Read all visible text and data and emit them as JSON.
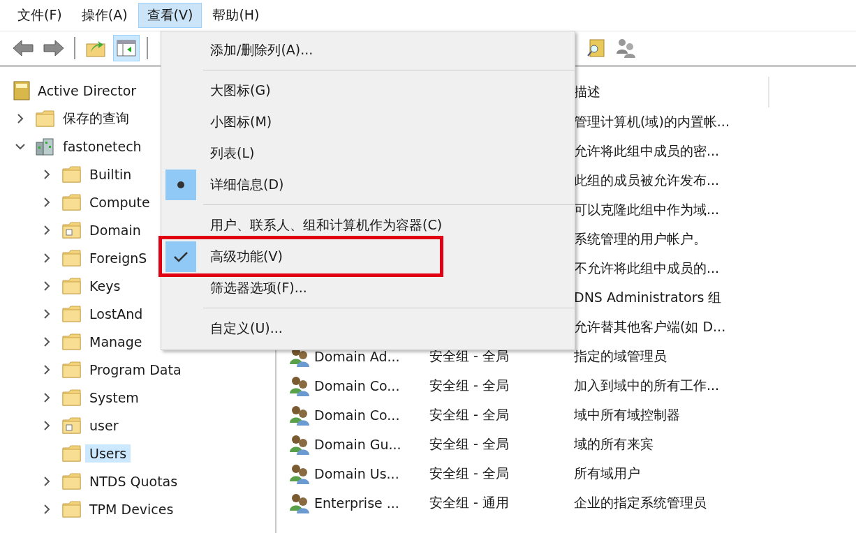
{
  "menubar": [
    {
      "label": "文件(F)",
      "selected": false
    },
    {
      "label": "操作(A)",
      "selected": false
    },
    {
      "label": "查看(V)",
      "selected": true
    },
    {
      "label": "帮助(H)",
      "selected": false
    }
  ],
  "toolbar": [
    {
      "kind": "back",
      "pressed": false
    },
    {
      "kind": "forward",
      "pressed": false
    },
    {
      "kind": "separator"
    },
    {
      "kind": "up",
      "pressed": false
    },
    {
      "kind": "console",
      "pressed": true
    },
    {
      "kind": "separator"
    },
    {
      "kind": "gap"
    },
    {
      "kind": "find",
      "pressed": false
    },
    {
      "kind": "users",
      "pressed": false
    }
  ],
  "tree": [
    {
      "label": "Active Director",
      "kind": "root",
      "selected": false,
      "children": [
        {
          "label": "保存的查询",
          "kind": "folder",
          "expanded": false,
          "selected": false
        },
        {
          "label": "fastonetech",
          "kind": "domain",
          "expanded": true,
          "selected": false,
          "children": [
            {
              "label": "Builtin",
              "kind": "folder",
              "expanded": false,
              "selected": false
            },
            {
              "label": "Compute",
              "kind": "folder",
              "expanded": false,
              "selected": false
            },
            {
              "label": "Domain",
              "kind": "ou",
              "expanded": false,
              "selected": false
            },
            {
              "label": "ForeignS",
              "kind": "folder",
              "expanded": false,
              "selected": false
            },
            {
              "label": "Keys",
              "kind": "folder",
              "expanded": false,
              "selected": false
            },
            {
              "label": "LostAnd",
              "kind": "folder",
              "expanded": false,
              "selected": false
            },
            {
              "label": "Manage",
              "kind": "folder",
              "expanded": false,
              "selected": false
            },
            {
              "label": "Program Data",
              "kind": "folder",
              "expanded": false,
              "selected": false
            },
            {
              "label": "System",
              "kind": "folder",
              "expanded": false,
              "selected": false
            },
            {
              "label": "user",
              "kind": "ou",
              "expanded": false,
              "selected": false
            },
            {
              "label": "Users",
              "kind": "folder",
              "selected": true
            },
            {
              "label": "NTDS Quotas",
              "kind": "folder",
              "expanded": false,
              "selected": false
            },
            {
              "label": "TPM Devices",
              "kind": "folder",
              "expanded": false,
              "selected": false
            }
          ]
        }
      ]
    }
  ],
  "list": {
    "columns": {
      "description": "描述"
    },
    "rows": [
      {
        "description": "管理计算机(域)的内置帐..."
      },
      {
        "description": "允许将此组中成员的密..."
      },
      {
        "description": "此组的成员被允许发布..."
      },
      {
        "description": "可以克隆此组中作为域..."
      },
      {
        "description": "系统管理的用户帐户。"
      },
      {
        "description": "不允许将此组中成员的..."
      },
      {
        "description": "DNS Administrators 组"
      },
      {
        "description": "允许替其他客户端(如 D..."
      },
      {
        "name": "Domain Ad...",
        "type": "安全组 - 全局",
        "description": "指定的域管理员"
      },
      {
        "name": "Domain Co...",
        "type": "安全组 - 全局",
        "description": "加入到域中的所有工作..."
      },
      {
        "name": "Domain Co...",
        "type": "安全组 - 全局",
        "description": "域中所有域控制器"
      },
      {
        "name": "Domain Gu...",
        "type": "安全组 - 全局",
        "description": "域的所有来宾"
      },
      {
        "name": "Domain Us...",
        "type": "安全组 - 全局",
        "description": "所有域用户"
      },
      {
        "name": "Enterprise ...",
        "type": "安全组 - 通用",
        "description": "企业的指定系统管理员"
      }
    ]
  },
  "view_menu": [
    {
      "kind": "command",
      "label": "添加/删除列(A)...",
      "annotated": false
    },
    {
      "kind": "separator"
    },
    {
      "kind": "radio",
      "label": "大图标(G)",
      "checked": false,
      "annotated": false
    },
    {
      "kind": "radio",
      "label": "小图标(M)",
      "checked": false,
      "annotated": false
    },
    {
      "kind": "radio",
      "label": "列表(L)",
      "checked": false,
      "annotated": false
    },
    {
      "kind": "radio",
      "label": "详细信息(D)",
      "checked": true,
      "annotated": false
    },
    {
      "kind": "separator"
    },
    {
      "kind": "toggle",
      "label": "用户、联系人、组和计算机作为容器(C)",
      "checked": false,
      "annotated": false
    },
    {
      "kind": "toggle",
      "label": "高级功能(V)",
      "checked": true,
      "annotated": true
    },
    {
      "kind": "command",
      "label": "筛选器选项(F)...",
      "annotated": false
    },
    {
      "kind": "separator"
    },
    {
      "kind": "command",
      "label": "自定义(U)...",
      "annotated": false
    }
  ]
}
